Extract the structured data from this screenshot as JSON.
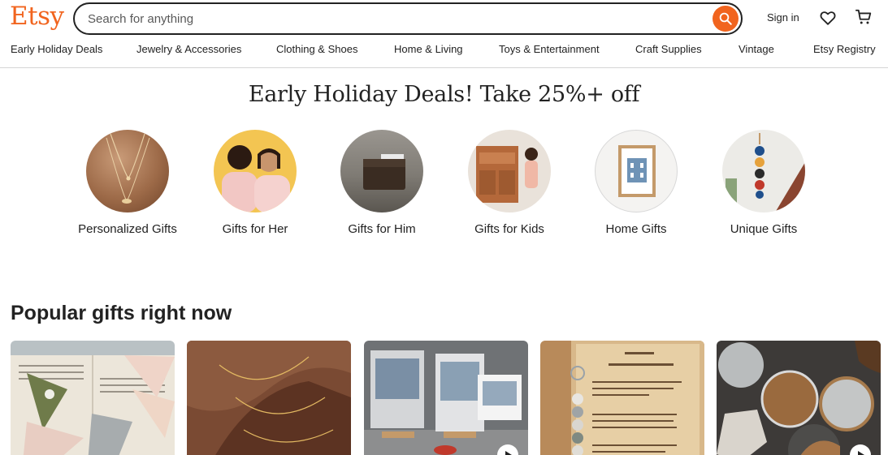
{
  "header": {
    "logo": "Etsy",
    "search_placeholder": "Search for anything",
    "signin": "Sign in"
  },
  "nav": [
    "Early Holiday Deals",
    "Jewelry & Accessories",
    "Clothing & Shoes",
    "Home & Living",
    "Toys & Entertainment",
    "Craft Supplies",
    "Vintage",
    "Etsy Registry"
  ],
  "banner": "Early Holiday Deals! Take 25%+ off",
  "categories": [
    "Personalized Gifts",
    "Gifts for Her",
    "Gifts for Him",
    "Gifts for Kids",
    "Home Gifts",
    "Unique Gifts"
  ],
  "popular_title": "Popular gifts right now",
  "colors": {
    "accent": "#F1641E",
    "text": "#222222"
  }
}
